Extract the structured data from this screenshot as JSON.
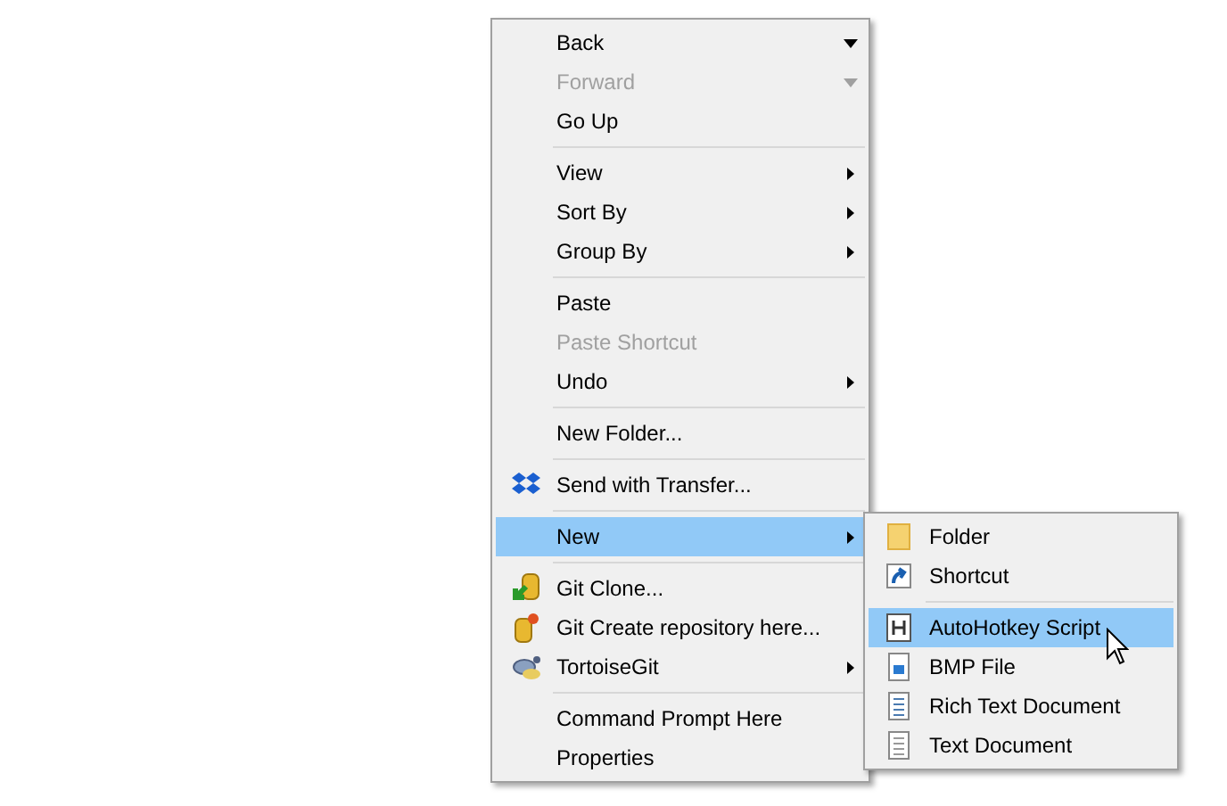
{
  "menu": {
    "items": [
      {
        "kind": "item",
        "label": "Back",
        "disabled": false,
        "selected": false,
        "dropdown": true
      },
      {
        "kind": "item",
        "label": "Forward",
        "disabled": true,
        "selected": false,
        "dropdown": true
      },
      {
        "kind": "item",
        "label": "Go Up",
        "disabled": false,
        "selected": false
      },
      {
        "kind": "separator"
      },
      {
        "kind": "item",
        "label": "View",
        "disabled": false,
        "selected": false,
        "submenu": true
      },
      {
        "kind": "item",
        "label": "Sort By",
        "disabled": false,
        "selected": false,
        "submenu": true
      },
      {
        "kind": "item",
        "label": "Group By",
        "disabled": false,
        "selected": false,
        "submenu": true
      },
      {
        "kind": "separator"
      },
      {
        "kind": "item",
        "label": "Paste",
        "disabled": false,
        "selected": false
      },
      {
        "kind": "item",
        "label": "Paste Shortcut",
        "disabled": true,
        "selected": false
      },
      {
        "kind": "item",
        "label": "Undo",
        "disabled": false,
        "selected": false,
        "submenu": true
      },
      {
        "kind": "separator"
      },
      {
        "kind": "item",
        "label": "New Folder...",
        "disabled": false,
        "selected": false
      },
      {
        "kind": "separator"
      },
      {
        "kind": "item",
        "label": "Send with Transfer...",
        "disabled": false,
        "selected": false
      },
      {
        "kind": "separator"
      },
      {
        "kind": "item",
        "label": "New",
        "disabled": false,
        "selected": true,
        "submenu": true
      },
      {
        "kind": "separator"
      },
      {
        "kind": "item",
        "label": "Git Clone...",
        "disabled": false,
        "selected": false
      },
      {
        "kind": "item",
        "label": "Git Create repository here...",
        "disabled": false,
        "selected": false
      },
      {
        "kind": "item",
        "label": "TortoiseGit",
        "disabled": false,
        "selected": false,
        "submenu": true
      },
      {
        "kind": "separator"
      },
      {
        "kind": "item",
        "label": "Command Prompt Here",
        "disabled": false,
        "selected": false
      },
      {
        "kind": "item",
        "label": "Properties",
        "disabled": false,
        "selected": false
      }
    ]
  },
  "submenu": {
    "items": [
      {
        "kind": "item",
        "label": "Folder",
        "selected": false
      },
      {
        "kind": "item",
        "label": "Shortcut",
        "selected": false
      },
      {
        "kind": "separator"
      },
      {
        "kind": "item",
        "label": "AutoHotkey Script",
        "selected": true
      },
      {
        "kind": "item",
        "label": "BMP File",
        "selected": false
      },
      {
        "kind": "item",
        "label": "Rich Text Document",
        "selected": false
      },
      {
        "kind": "item",
        "label": "Text Document",
        "selected": false
      }
    ]
  }
}
